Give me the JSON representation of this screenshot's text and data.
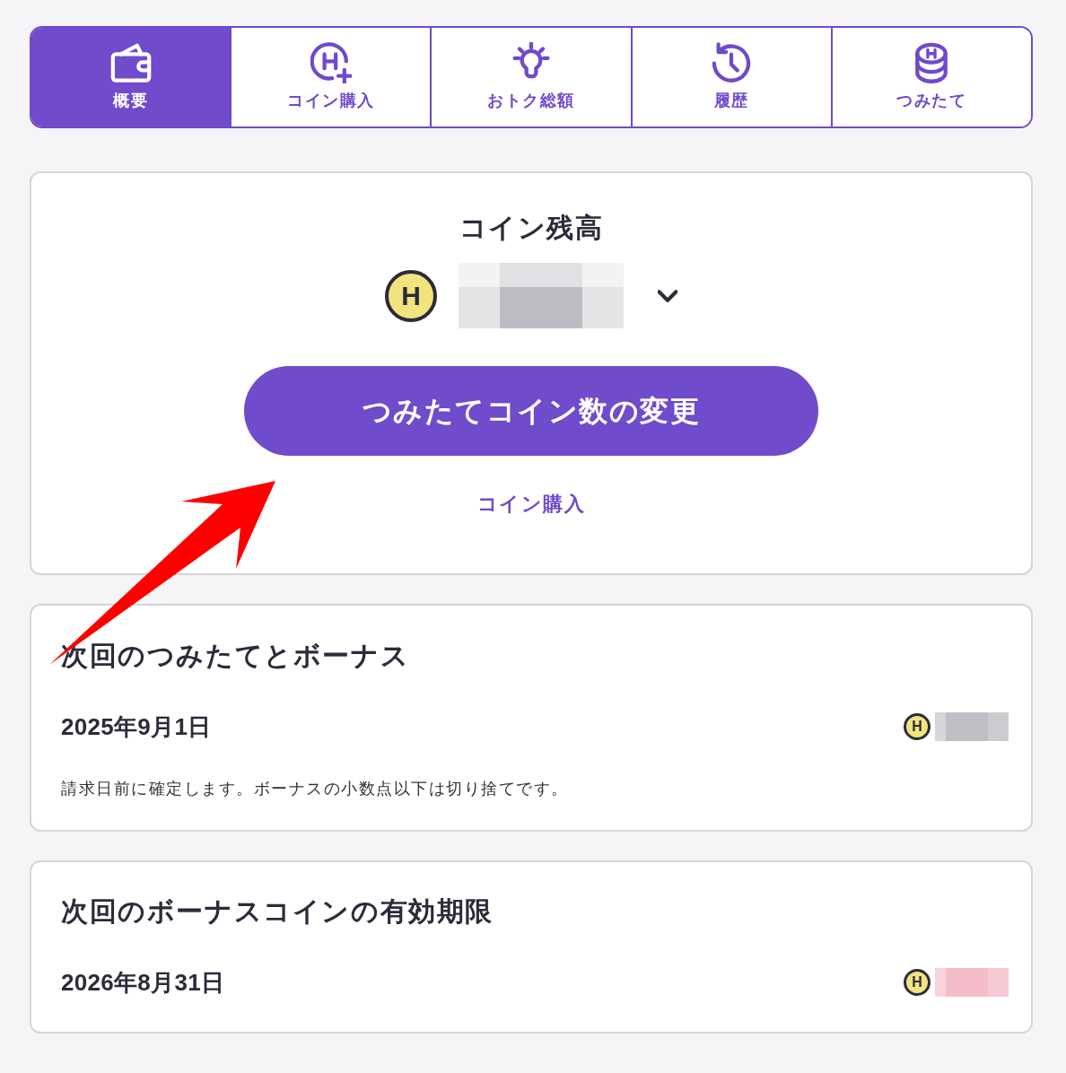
{
  "tabs": [
    {
      "label": "概要",
      "selected": true
    },
    {
      "label": "コイン購入",
      "selected": false
    },
    {
      "label": "おトク総額",
      "selected": false
    },
    {
      "label": "履歴",
      "selected": false
    },
    {
      "label": "つみたて",
      "selected": false
    }
  ],
  "balance_card": {
    "title": "コイン残高",
    "coin_symbol": "H",
    "balance": {
      "color": "#bdbcc2"
    },
    "expanded": false,
    "primary_button": "つみたてコイン数の変更",
    "link": "コイン購入"
  },
  "schedule_cards": [
    {
      "title": "次回のつみたてとボーナス",
      "date": "2025年9月1日",
      "coin_symbol": "H",
      "amount": {
        "color": "#c0bfc5"
      },
      "note": "請求日前に確定します。ボーナスの小数点以下は切り捨てです。"
    },
    {
      "title": "次回のボーナスコインの有効期限",
      "date": "2026年8月31日",
      "coin_symbol": "H",
      "amount": {
        "color": "#f4bcc8"
      }
    }
  ],
  "annotations": [
    {
      "kind": "arrow"
    }
  ]
}
